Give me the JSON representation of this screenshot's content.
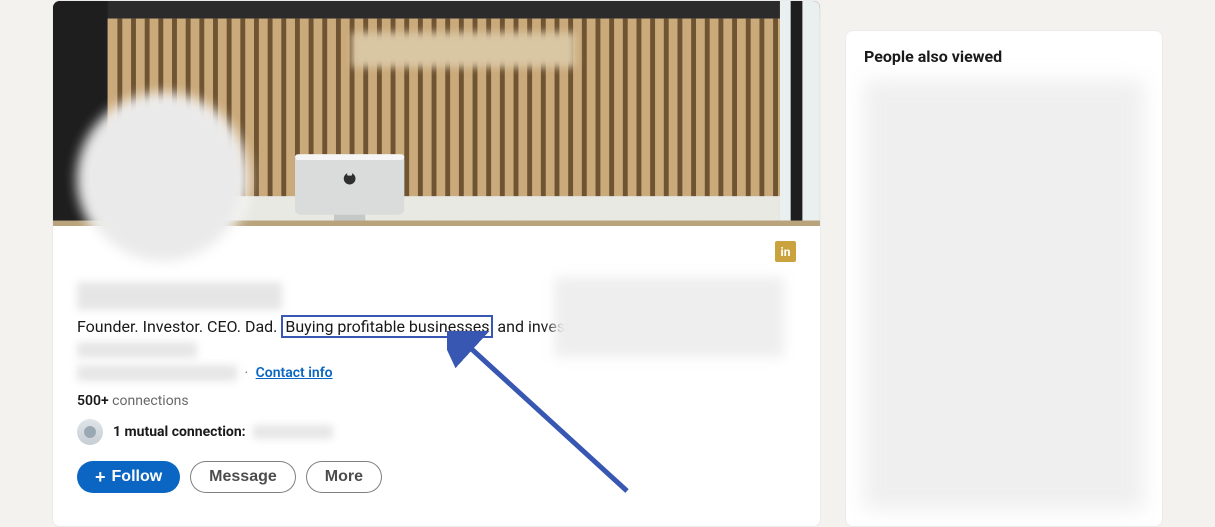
{
  "profile": {
    "headline_prefix": "Founder. Investor. CEO. Dad.",
    "headline_highlight": "Buying profitable businesses",
    "headline_mid": " and investing in startups at ",
    "contact_info": "Contact info",
    "connections_count": "500+",
    "connections_label": " connections",
    "mutual_label": "1 mutual connection:"
  },
  "actions": {
    "follow": "Follow",
    "message": "Message",
    "more": "More"
  },
  "sidebar": {
    "title": "People also viewed"
  },
  "icons": {
    "linkedin": "in"
  }
}
